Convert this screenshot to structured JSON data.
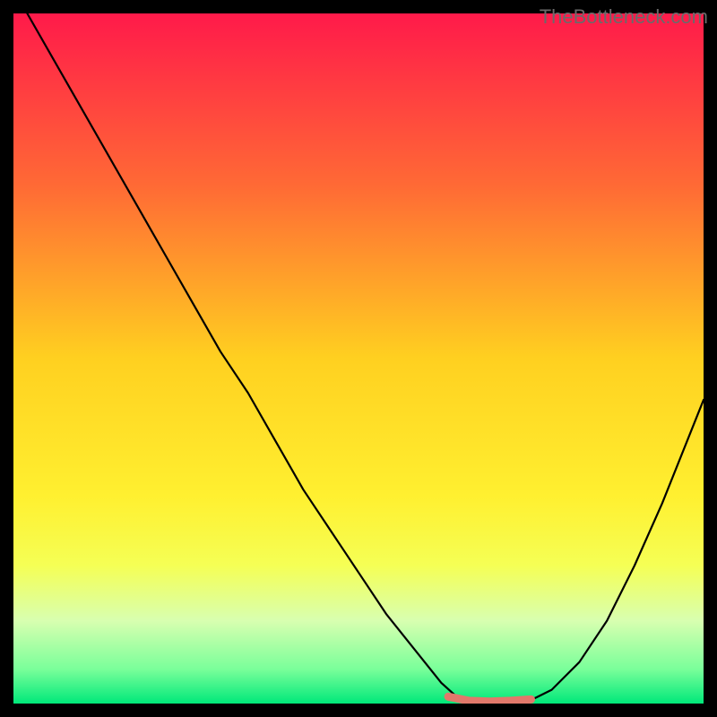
{
  "watermark": "TheBottleneck.com",
  "chart_data": {
    "type": "line",
    "title": "",
    "xlabel": "",
    "ylabel": "",
    "xlim": [
      0,
      100
    ],
    "ylim": [
      0,
      100
    ],
    "gradient_stops": [
      {
        "offset": 0.0,
        "color": "#ff1a4a"
      },
      {
        "offset": 0.25,
        "color": "#ff6a35"
      },
      {
        "offset": 0.5,
        "color": "#ffd020"
      },
      {
        "offset": 0.7,
        "color": "#fff030"
      },
      {
        "offset": 0.8,
        "color": "#f5ff55"
      },
      {
        "offset": 0.88,
        "color": "#d8ffb0"
      },
      {
        "offset": 0.95,
        "color": "#7aff9a"
      },
      {
        "offset": 1.0,
        "color": "#00e87a"
      }
    ],
    "series": [
      {
        "name": "bottleneck-curve",
        "color": "#000000",
        "width": 2.2,
        "x": [
          2,
          6,
          10,
          14,
          18,
          22,
          26,
          30,
          34,
          38,
          42,
          46,
          50,
          54,
          58,
          62,
          64,
          68,
          72,
          75,
          78,
          82,
          86,
          90,
          94,
          98,
          100
        ],
        "y": [
          100,
          93,
          86,
          79,
          72,
          65,
          58,
          51,
          45,
          38,
          31,
          25,
          19,
          13,
          8,
          3,
          1.2,
          0.4,
          0.3,
          0.5,
          2,
          6,
          12,
          20,
          29,
          39,
          44
        ]
      },
      {
        "name": "optimal-band",
        "color": "#e2786b",
        "width": 9,
        "x": [
          63,
          66,
          69,
          72,
          75
        ],
        "y": [
          1.0,
          0.4,
          0.3,
          0.4,
          0.6
        ]
      }
    ]
  }
}
